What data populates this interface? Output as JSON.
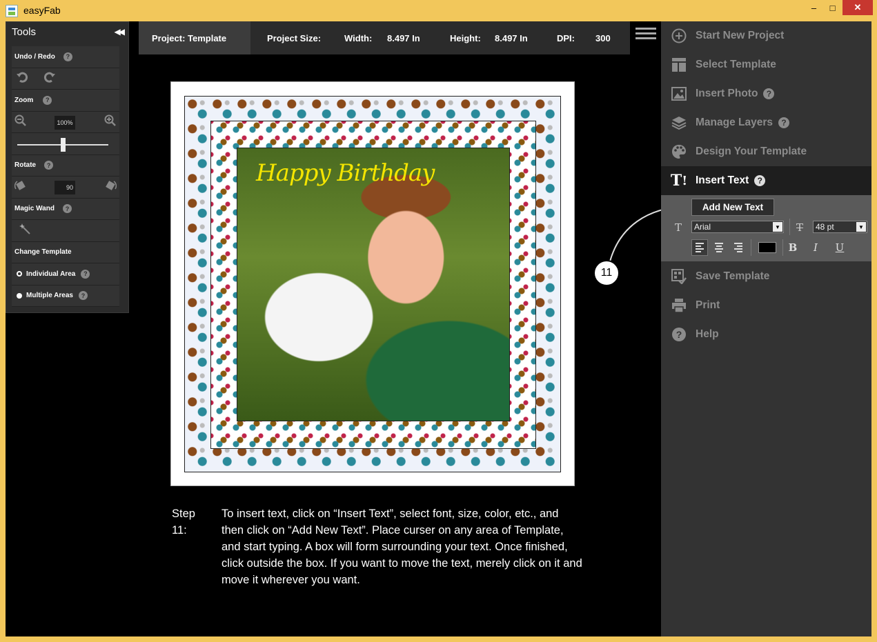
{
  "window": {
    "title": "easyFab",
    "min_glyph": "–",
    "max_glyph": "□",
    "close_glyph": "✕"
  },
  "tools": {
    "title": "Tools",
    "collapse_glyph": "◀◀",
    "undo_redo": "Undo / Redo",
    "zoom": "Zoom",
    "zoom_value": "100%",
    "zoom_level": 0.5,
    "rotate": "Rotate",
    "rotate_value": "90",
    "magic_wand": "Magic Wand",
    "change_template": "Change Template",
    "individual_area": "Individual Area",
    "multiple_areas": "Multiple Areas",
    "help": "?"
  },
  "infobar": {
    "project": "Project: Template",
    "size_label": "Project Size:",
    "width_label": "Width:",
    "width_value": "8.497 In",
    "height_label": "Height:",
    "height_value": "8.497 In",
    "dpi_label": "DPI:",
    "dpi_value": "300"
  },
  "canvas": {
    "text": "Happy Birthday"
  },
  "caption": {
    "label": "Step 11:",
    "lines": [
      "To insert text, click on “Insert Text”, select font, size, color, etc., and",
      "then click on “Add New Text”.  Place curser on any area of Template,",
      "and start typing. A box will form surrounding your text. Once finished,",
      "click outside the box. If you want to move the text, merely click on it and",
      "move it wherever you want."
    ]
  },
  "badge": "11",
  "menu": {
    "start_new": "Start New Project",
    "select_template": "Select Template",
    "insert_photo": "Insert Photo",
    "manage_layers": "Manage Layers",
    "design_template": "Design Your Template",
    "insert_text": "Insert Text",
    "save_template": "Save Template",
    "print": "Print",
    "help": "Help",
    "help_glyph": "?"
  },
  "text_panel": {
    "add_new_text": "Add New Text",
    "font": "Arial",
    "size": "48 pt",
    "bold": "B",
    "italic": "I",
    "underline": "U",
    "text_color": "#000000"
  },
  "colors": {
    "frame": "#f2c75b",
    "close": "#c7372f",
    "birthday_text": "#f4e500"
  }
}
